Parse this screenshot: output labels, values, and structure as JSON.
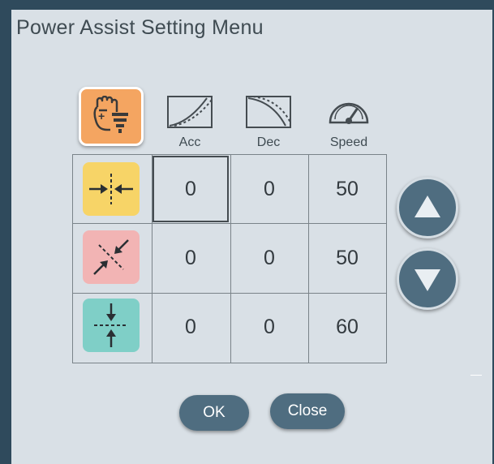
{
  "window": {
    "title": "Power Assist Setting Menu"
  },
  "columns": [
    {
      "label": "Acc",
      "icon": "acceleration-curve-icon"
    },
    {
      "label": "Dec",
      "icon": "deceleration-curve-icon"
    },
    {
      "label": "Speed",
      "icon": "speedometer-icon"
    }
  ],
  "mode_button": {
    "icon": "hand-power-assist-icon",
    "color": "#f4a561"
  },
  "rows": [
    {
      "name": "row-1",
      "icon": "horizontal-inward-arrows-icon",
      "color": "#f7d467",
      "acc": "0",
      "dec": "0",
      "speed": "50"
    },
    {
      "name": "row-2",
      "icon": "diagonal-inward-arrows-icon",
      "color": "#f2b4b4",
      "acc": "0",
      "dec": "0",
      "speed": "50"
    },
    {
      "name": "row-3",
      "icon": "vertical-inward-arrows-icon",
      "color": "#7fcfc7",
      "acc": "0",
      "dec": "0",
      "speed": "60"
    }
  ],
  "buttons": {
    "ok": "OK",
    "close": "Close",
    "up": "up-arrow-icon",
    "down": "down-arrow-icon"
  },
  "colors": {
    "button": "#4f6d80",
    "frame": "#2f4a5c",
    "background": "#d9e0e6"
  }
}
